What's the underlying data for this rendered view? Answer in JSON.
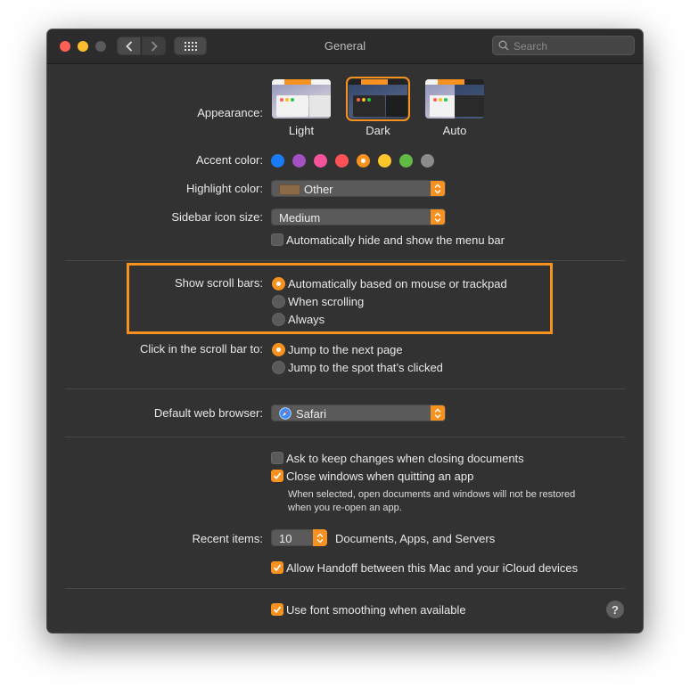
{
  "window": {
    "title": "General"
  },
  "search": {
    "placeholder": "Search"
  },
  "appearance": {
    "label": "Appearance:",
    "options": [
      {
        "label": "Light"
      },
      {
        "label": "Dark"
      },
      {
        "label": "Auto"
      }
    ],
    "selected": "Dark"
  },
  "accent": {
    "label": "Accent color:",
    "colors": [
      "#1a7cf5",
      "#a550c2",
      "#f5549b",
      "#ff5257",
      "#f7911f",
      "#ffc62b",
      "#62ba46",
      "#8c8c8c"
    ],
    "selected_index": 4
  },
  "highlight": {
    "label": "Highlight color:",
    "value": "Other",
    "swatch": "#8b6a47"
  },
  "sidebar_icon": {
    "label": "Sidebar icon size:",
    "value": "Medium"
  },
  "menu_bar": {
    "label": "Automatically hide and show the menu bar",
    "checked": false
  },
  "scroll_bars": {
    "label": "Show scroll bars:",
    "options": [
      "Automatically based on mouse or trackpad",
      "When scrolling",
      "Always"
    ],
    "selected_index": 0
  },
  "click_scroll": {
    "label": "Click in the scroll bar to:",
    "options": [
      "Jump to the next page",
      "Jump to the spot that’s clicked"
    ],
    "selected_index": 0
  },
  "browser": {
    "label": "Default web browser:",
    "value": "Safari"
  },
  "ask_keep": {
    "label": "Ask to keep changes when closing documents",
    "checked": false
  },
  "close_windows": {
    "label": "Close windows when quitting an app",
    "checked": true,
    "note_line1": "When selected, open documents and windows will not be restored",
    "note_line2": "when you re-open an app."
  },
  "recent": {
    "label": "Recent items:",
    "value": "10",
    "suffix": "Documents, Apps, and Servers"
  },
  "handoff": {
    "label": "Allow Handoff between this Mac and your iCloud devices",
    "checked": true
  },
  "smoothing": {
    "label": "Use font smoothing when available",
    "checked": true
  },
  "help": {
    "label": "?"
  },
  "colors": {
    "accent": "#f7911f",
    "background": "#323232"
  }
}
